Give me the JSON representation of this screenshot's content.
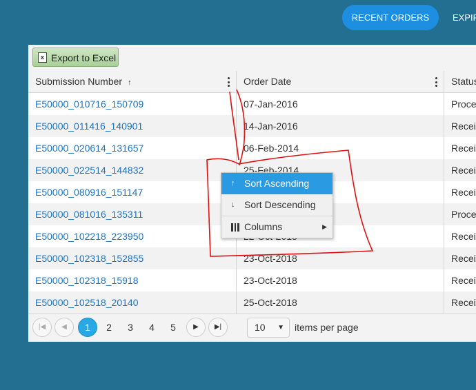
{
  "tabs": {
    "recent_orders": "RECENT ORDERS",
    "expired": "EXPIR"
  },
  "toolbar": {
    "export_label": "Export to Excel",
    "export_icon": "excel-icon"
  },
  "columns": [
    {
      "label": "Submission Number",
      "sort_indicator": "↑"
    },
    {
      "label": "Order Date"
    },
    {
      "label": "Status"
    }
  ],
  "rows": [
    {
      "submission": "E50000_010716_150709",
      "date": "07-Jan-2016",
      "status": "Proce"
    },
    {
      "submission": "E50000_011416_140901",
      "date": "14-Jan-2016",
      "status": "Recei"
    },
    {
      "submission": "E50000_020614_131657",
      "date": "06-Feb-2014",
      "status": "Recei"
    },
    {
      "submission": "E50000_022514_144832",
      "date": "25-Feb-2014",
      "status": "Recei"
    },
    {
      "submission": "E50000_080916_151147",
      "date": "",
      "status": "Recei"
    },
    {
      "submission": "E50000_081016_135311",
      "date": "",
      "status": "Proce"
    },
    {
      "submission": "E50000_102218_223950",
      "date": "22-Oct-2018",
      "status": "Recei"
    },
    {
      "submission": "E50000_102318_152855",
      "date": "23-Oct-2018",
      "status": "Recei"
    },
    {
      "submission": "E50000_102318_15918",
      "date": "23-Oct-2018",
      "status": "Recei"
    },
    {
      "submission": "E50000_102518_20140",
      "date": "25-Oct-2018",
      "status": "Recei"
    }
  ],
  "pager": {
    "pages": [
      "1",
      "2",
      "3",
      "4",
      "5"
    ],
    "current_page": "1",
    "page_size": "10",
    "items_per_page_label": "items per page"
  },
  "context_menu": {
    "sort_ascending": "Sort Ascending",
    "sort_descending": "Sort Descending",
    "columns": "Columns"
  },
  "colors": {
    "background": "#236f91",
    "accent": "#2a9ae3",
    "link": "#1a73c8",
    "annotation": "#e01010"
  }
}
